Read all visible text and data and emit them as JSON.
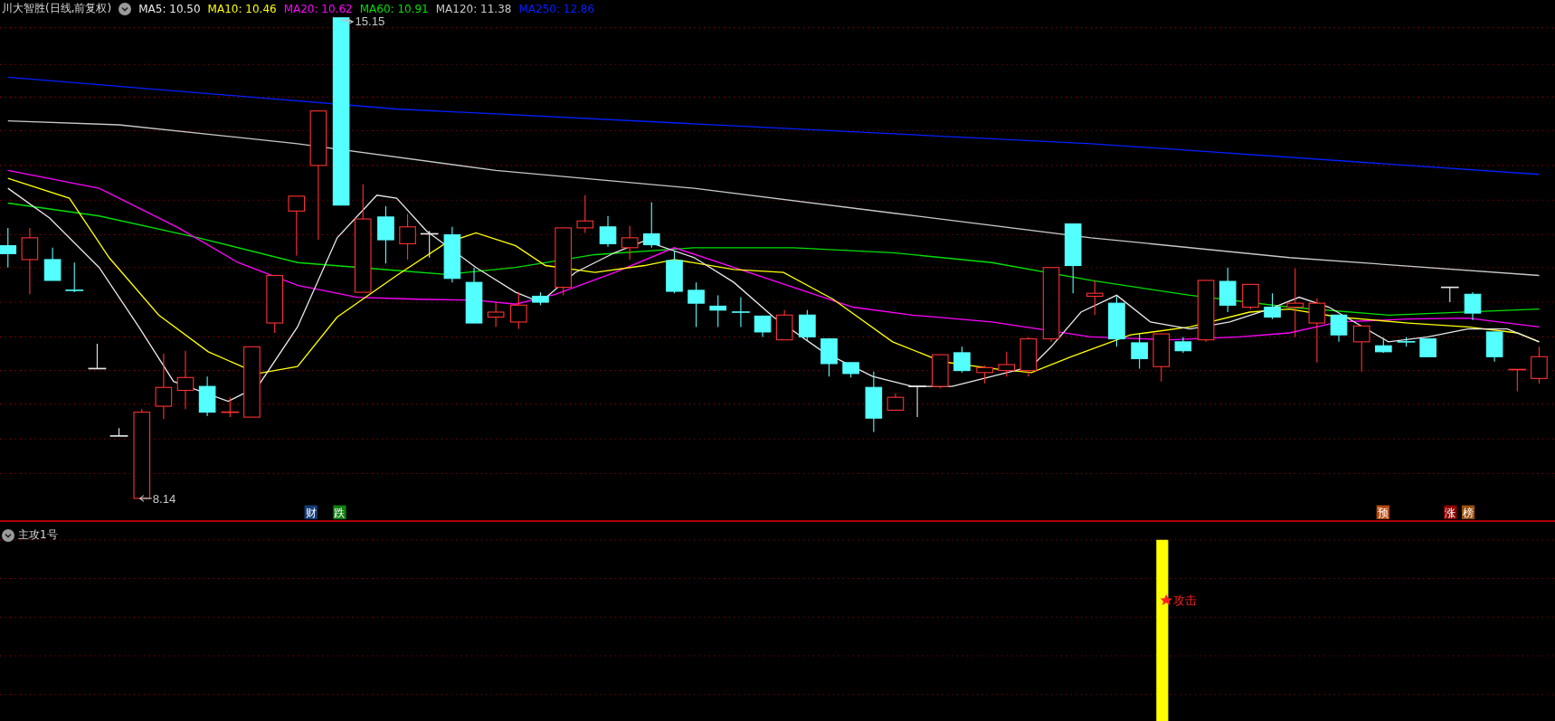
{
  "chart_header": {
    "title": "川大智胜(日线,前复权)",
    "ma_legend": [
      {
        "label": "MA5: 10.50",
        "color": "#e8e8e8"
      },
      {
        "label": "MA10: 10.46",
        "color": "#ffff00"
      },
      {
        "label": "MA20: 10.62",
        "color": "#ff00ff"
      },
      {
        "label": "MA60: 10.91",
        "color": "#00e000"
      },
      {
        "label": "MA120: 11.38",
        "color": "#c8c8c8"
      },
      {
        "label": "MA250: 12.86",
        "color": "#0020ff"
      }
    ]
  },
  "price_labels": {
    "high": "15.15",
    "low": "8.14"
  },
  "event_badges": [
    {
      "text": "财",
      "color": "#143c78"
    },
    {
      "text": "跌",
      "color": "#108010"
    },
    {
      "text": "预",
      "color": "#b84a10"
    },
    {
      "text": "涨",
      "color": "#900000"
    },
    {
      "text": "榜",
      "color": "#9a5010"
    }
  ],
  "indicator_panel": {
    "title": "主攻1号",
    "signal_label": "攻击"
  }
}
